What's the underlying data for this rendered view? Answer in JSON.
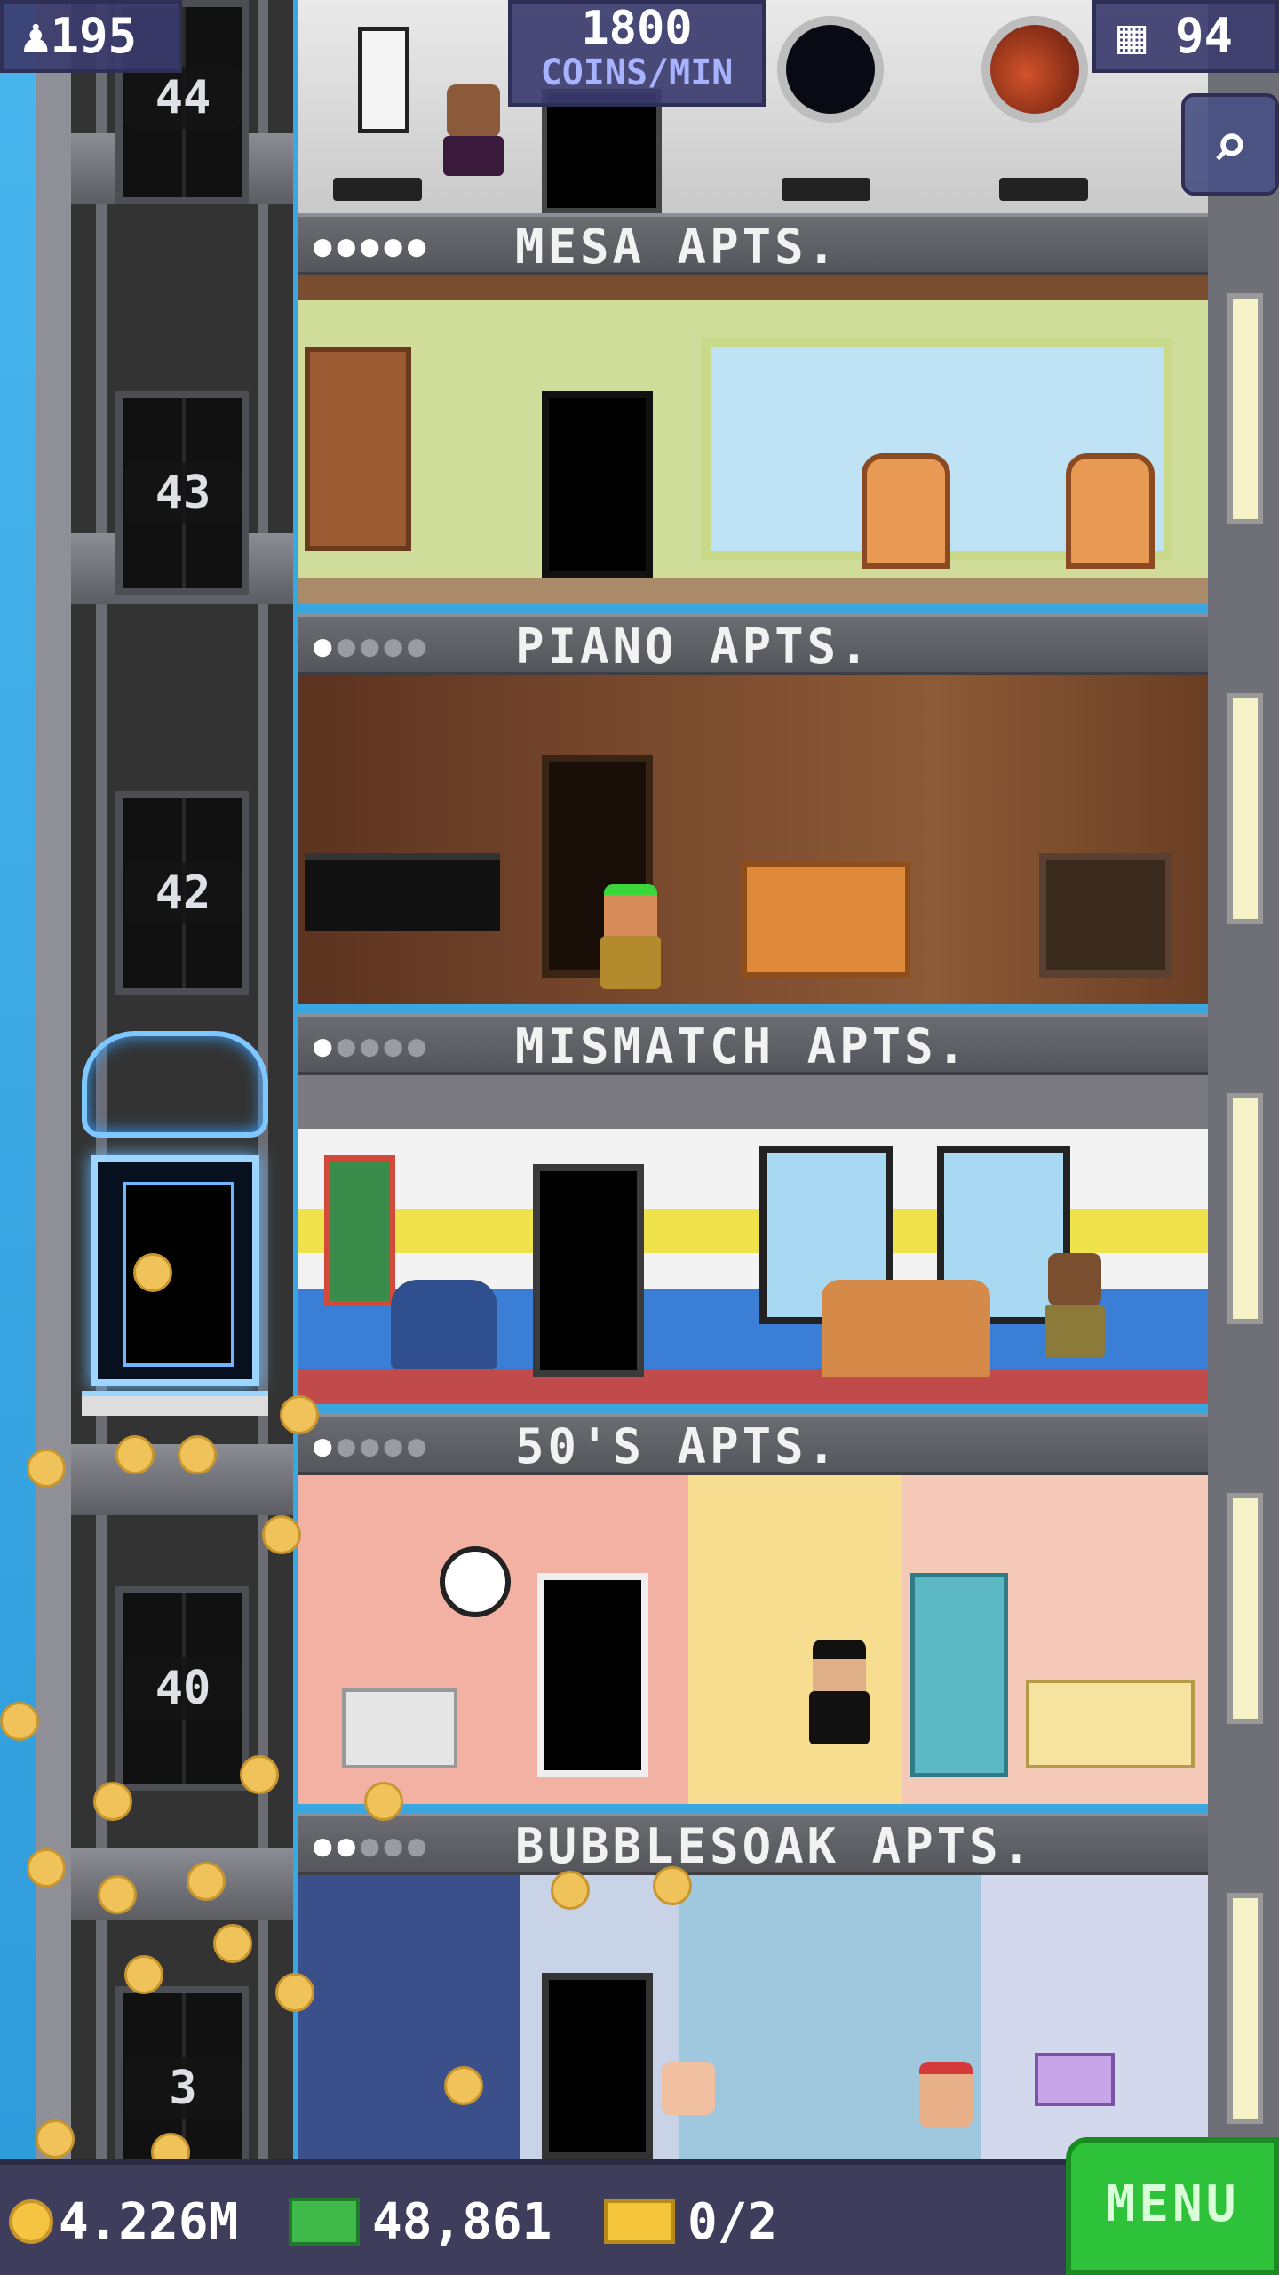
{
  "hud": {
    "population": "195",
    "coins_per_min_value": "1800",
    "coins_per_min_unit": "COINS/MIN",
    "floors": "94",
    "search_icon": "magnifier-icon"
  },
  "elevator": {
    "floor_numbers": [
      "44",
      "43",
      "42",
      "40",
      "3"
    ]
  },
  "floors": [
    {
      "name": "MESA APTS.",
      "stars_filled": 5,
      "stars_total": 5
    },
    {
      "name": "PIANO APTS.",
      "stars_filled": 1,
      "stars_total": 5
    },
    {
      "name": "MISMATCH APTS.",
      "stars_filled": 1,
      "stars_total": 5
    },
    {
      "name": "50'S APTS.",
      "stars_filled": 1,
      "stars_total": 5
    },
    {
      "name": "BUBBLESOAK APTS.",
      "stars_filled": 2,
      "stars_total": 5
    }
  ],
  "bottom_bar": {
    "coins": "4.226M",
    "bux": "48,861",
    "tickets": "0/2",
    "menu_label": "MENU"
  },
  "colors": {
    "sky": "#3aa7e0",
    "hud_bg": "#3c3c6e",
    "menu_green": "#2ec13a",
    "coin_gold": "#f0c35a"
  }
}
